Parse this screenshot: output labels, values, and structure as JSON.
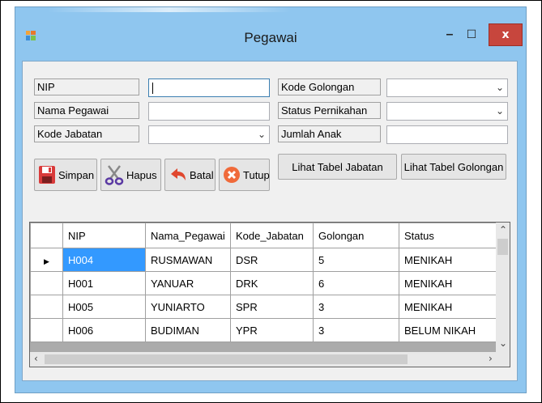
{
  "window": {
    "title": "Pegawai",
    "minimize_glyph": "–",
    "maximize_glyph": "☐",
    "close_glyph": "x"
  },
  "form": {
    "nip_label": "NIP",
    "nip_value": "",
    "nama_label": "Nama Pegawai",
    "nama_value": "",
    "kode_jabatan_label": "Kode Jabatan",
    "kode_jabatan_value": "",
    "kode_golongan_label": "Kode Golongan",
    "kode_golongan_value": "",
    "status_label": "Status Pernikahan",
    "status_value": "",
    "jumlah_anak_label": "Jumlah Anak",
    "jumlah_anak_value": ""
  },
  "buttons": {
    "simpan": "Simpan",
    "hapus": "Hapus",
    "batal": "Batal",
    "tutup": "Tutup",
    "lihat_jabatan": "Lihat Tabel Jabatan",
    "lihat_golongan": "Lihat Tabel Golongan"
  },
  "grid": {
    "columns": [
      "NIP",
      "Nama_Pegawai",
      "Kode_Jabatan",
      "Golongan",
      "Status"
    ],
    "rows": [
      [
        "H004",
        "RUSMAWAN",
        "DSR",
        "5",
        "MENIKAH"
      ],
      [
        "H001",
        "YANUAR",
        "DRK",
        "6",
        "MENIKAH"
      ],
      [
        "H005",
        "YUNIARTO",
        "SPR",
        "3",
        "MENIKAH"
      ],
      [
        "H006",
        "BUDIMAN",
        "YPR",
        "3",
        "BELUM NIKAH"
      ]
    ],
    "current_row_marker": "▶"
  },
  "icons": {
    "app": "app-window-icon",
    "simpan": "floppy-disk-icon",
    "hapus": "scissors-icon",
    "batal": "undo-arrow-icon",
    "tutup": "close-circle-icon"
  },
  "colors": {
    "title_bar": "#8fc6ef",
    "close_button": "#c7463d",
    "selected_cell": "#3399ff"
  }
}
